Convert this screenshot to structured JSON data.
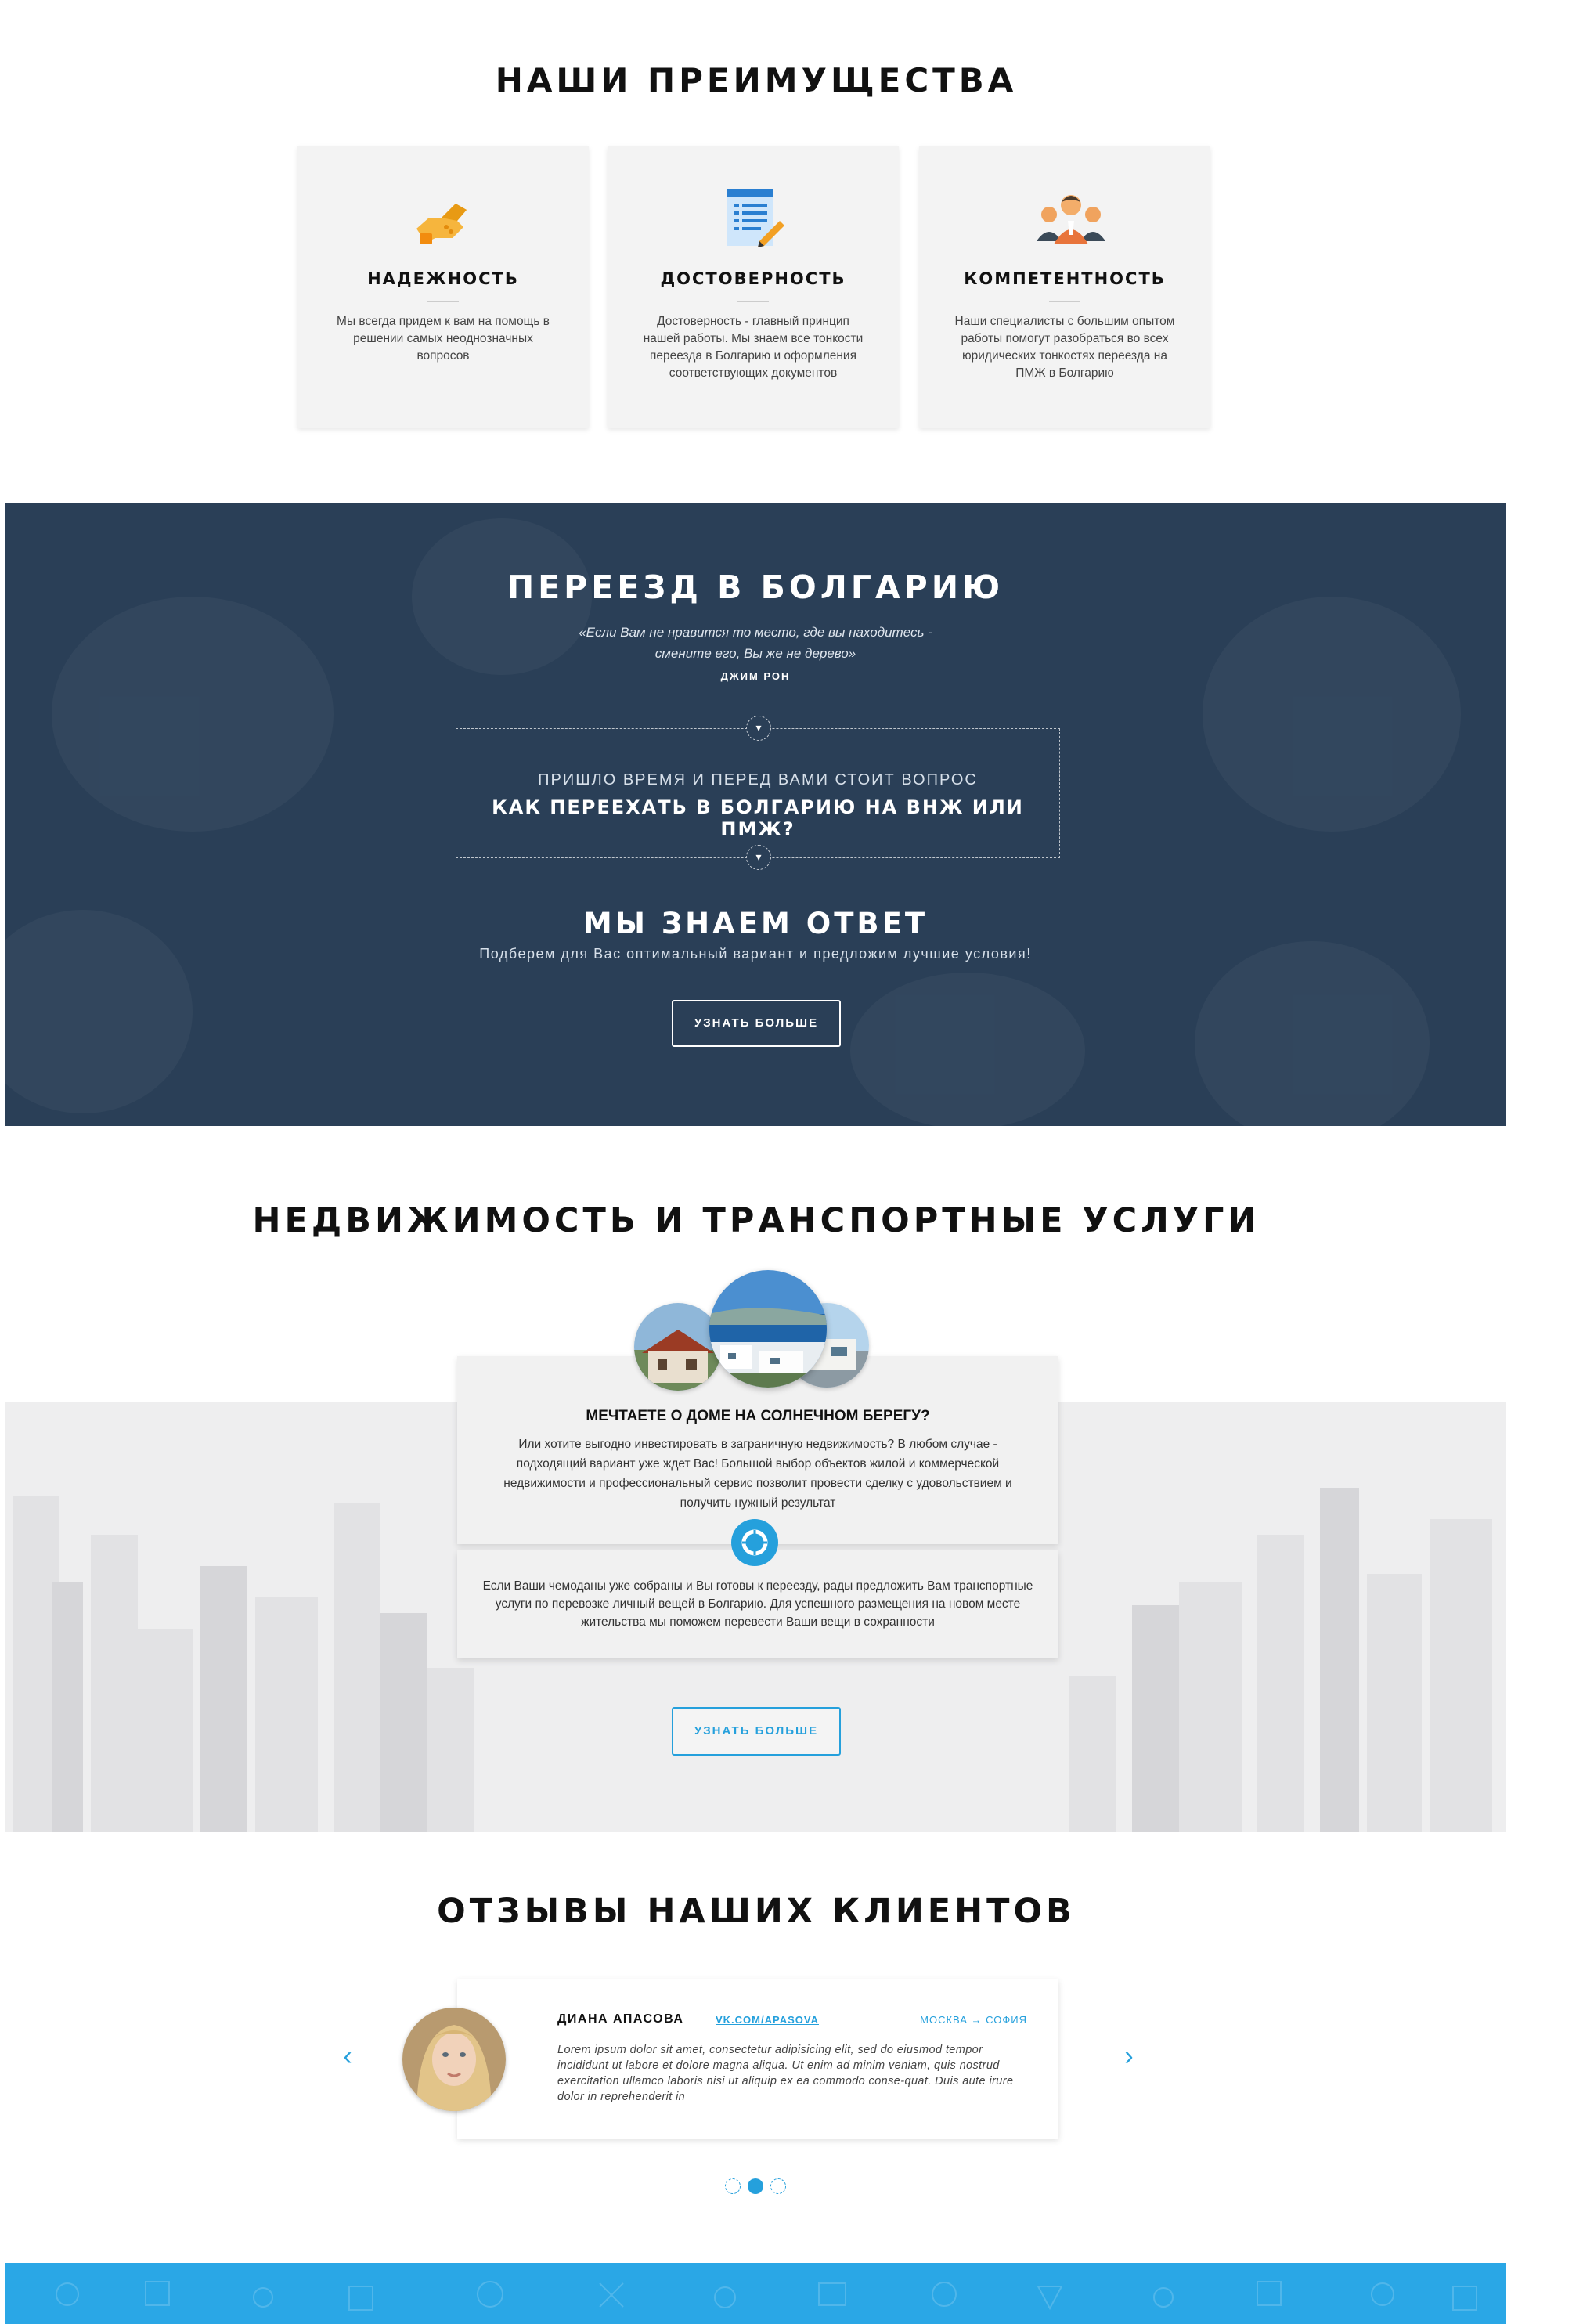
{
  "advantages": {
    "title": "НАШИ ПРЕИМУЩЕСТВА",
    "cards": [
      {
        "icon": "handshake-icon",
        "title": "НАДЕЖНОСТЬ",
        "text": "Мы всегда придем к вам на помощь в решении самых неоднозначных вопросов"
      },
      {
        "icon": "document-pencil-icon",
        "title": "ДОСТОВЕРНОСТЬ",
        "text": "Достоверность - главный принцип нашей работы. Мы знаем все тонкости переезда в Болгарию и оформления соответствующих документов"
      },
      {
        "icon": "team-icon",
        "title": "КОМПЕТЕНТНОСТЬ",
        "text": "Наши специалисты с большим опытом работы помогут разобраться во всех юридических тонкостях переезда на ПМЖ в Болгарию"
      }
    ]
  },
  "move": {
    "title": "ПЕРЕЕЗД В БОЛГАРИЮ",
    "quote_line1": "«Если Вам не нравится то место, где вы находитесь -",
    "quote_line2": "смените его, Вы же не дерево»",
    "author": "ДЖИМ РОН",
    "question_line1": "ПРИШЛО ВРЕМЯ И ПЕРЕД ВАМИ СТОИТ ВОПРОС",
    "question_line2": "КАК ПЕРЕЕХАТЬ В БОЛГАРИЮ НА ВНЖ ИЛИ ПМЖ?",
    "answer_title": "МЫ ЗНАЕМ ОТВЕТ",
    "answer_sub": "Подберем для Вас оптимальный вариант и предложим лучшие условия!",
    "button": "УЗНАТЬ БОЛЬШЕ"
  },
  "realty": {
    "title": "НЕДВИЖИМОСТЬ И ТРАНСПОРТНЫЕ УСЛУГИ",
    "card_title": "МЕЧТАЕТЕ О ДОМЕ НА СОЛНЕЧНОМ БЕРЕГУ?",
    "card_text": "Или хотите выгодно инвестировать в  заграничную недвижимость? В любом случае - подходящий вариант уже ждет Вас! Большой выбор объектов жилой и коммерческой недвижимости и профессиональный сервис позволит провести сделку с удовольствием и получить нужный результат",
    "transport_text": "Если Ваши чемоданы уже собраны и Вы готовы к переезду, рады предложить Вам транспортные услуги по перевозке личный вещей в Болгарию. Для успешного размещения на новом месте жительства мы поможем перевести Ваши вещи в сохранности",
    "button": "УЗНАТЬ БОЛЬШЕ"
  },
  "reviews": {
    "title": "ОТЗЫВЫ НАШИХ КЛИЕНТОВ",
    "name": "ДИАНА АПАСОВА",
    "link": "VK.COM/APASOVA",
    "route": "МОСКВА → СОФИЯ",
    "text": "Lorem ipsum dolor sit amet, consectetur adipisicing elit, sed do eiusmod tempor incididunt ut labore et dolore magna aliqua. Ut enim ad minim veniam, quis nostrud exercitation ullamco laboris nisi ut aliquip ex ea commodo conse-quat. Duis aute irure dolor in reprehenderit in",
    "prev": "‹",
    "next": "›",
    "active_slide": 2,
    "slide_count": 3
  },
  "colors": {
    "accent": "#25a0dc",
    "dark_section": "#2a3f57",
    "footer": "#2aa7e6"
  }
}
